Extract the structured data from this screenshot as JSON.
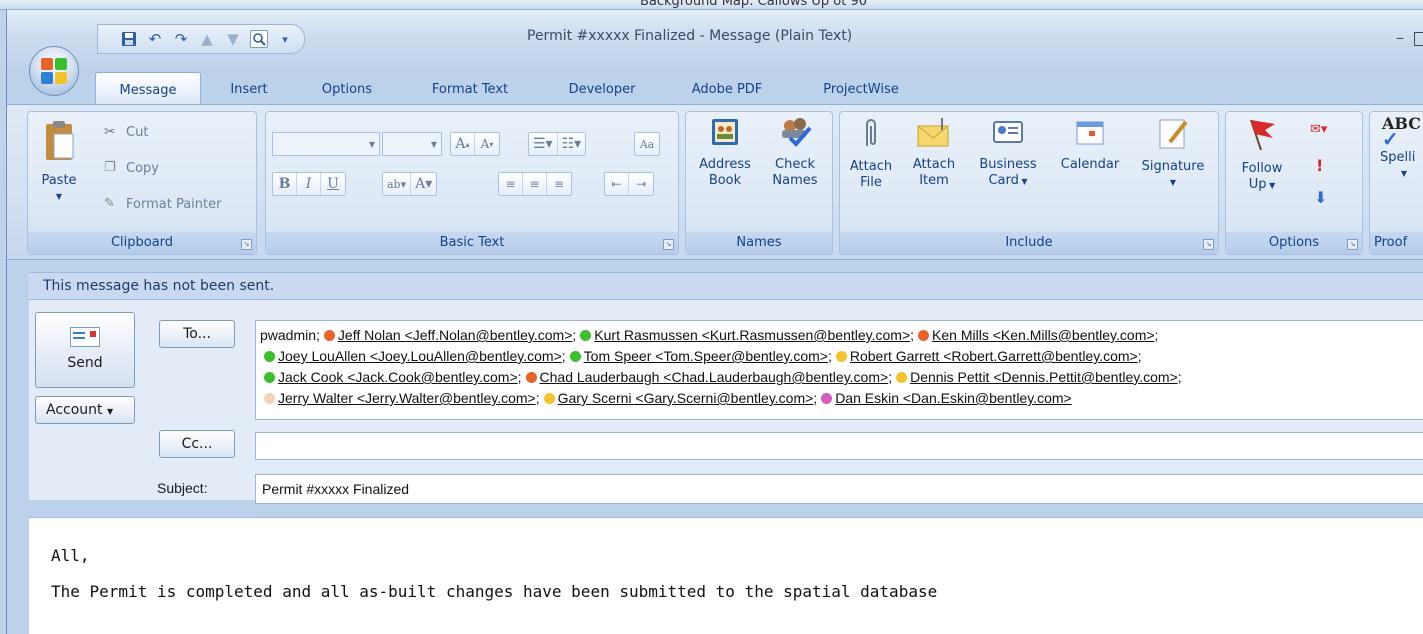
{
  "window": {
    "title": "Permit #xxxxx Finalized - Message (Plain Text)",
    "behind_text": "Background Map: Callows Up ot 90"
  },
  "tabs": [
    "Message",
    "Insert",
    "Options",
    "Format Text",
    "Developer",
    "Adobe PDF",
    "ProjectWise"
  ],
  "ribbon": {
    "clipboard": {
      "label": "Clipboard",
      "paste": "Paste",
      "cut": "Cut",
      "copy": "Copy",
      "format_painter": "Format Painter"
    },
    "basic_text": {
      "label": "Basic Text"
    },
    "names": {
      "label": "Names",
      "address_book": [
        "Address",
        "Book"
      ],
      "check_names": [
        "Check",
        "Names"
      ]
    },
    "include": {
      "label": "Include",
      "attach_file": [
        "Attach",
        "File"
      ],
      "attach_item": [
        "Attach",
        "Item"
      ],
      "business_card": [
        "Business",
        "Card"
      ],
      "calendar": "Calendar",
      "signature": "Signature"
    },
    "options": {
      "label": "Options",
      "follow_up": [
        "Follow",
        "Up"
      ]
    },
    "proofing": {
      "label": "Proof",
      "spelling": "Spelli"
    }
  },
  "info_bar": "This message has not been sent.",
  "compose": {
    "send": "Send",
    "account": "Account",
    "to_button": "To...",
    "cc_button": "Cc...",
    "subject_label": "Subject:",
    "subject": "Permit #xxxxx Finalized",
    "cc_value": "",
    "recipients_lines": [
      [
        {
          "text": "pwadmin;",
          "status": null
        },
        {
          "text": "Jeff Nolan <Jeff.Nolan@bentley.com>;",
          "status": "#e8632a"
        },
        {
          "text": "Kurt Rasmussen <Kurt.Rasmussen@bentley.com>;",
          "status": "#3bbf2c"
        },
        {
          "text": "Ken Mills <Ken.Mills@bentley.com>;",
          "status": "#e8632a"
        }
      ],
      [
        {
          "text": "Joey LouAllen <Joey.LouAllen@bentley.com>;",
          "status": "#3bbf2c"
        },
        {
          "text": "Tom Speer <Tom.Speer@bentley.com>;",
          "status": "#3bbf2c"
        },
        {
          "text": "Robert Garrett <Robert.Garrett@bentley.com>;",
          "status": "#f2c42b"
        }
      ],
      [
        {
          "text": "Jack Cook <Jack.Cook@bentley.com>;",
          "status": "#3bbf2c"
        },
        {
          "text": "Chad Lauderbaugh <Chad.Lauderbaugh@bentley.com>;",
          "status": "#e8632a"
        },
        {
          "text": "Dennis Pettit <Dennis.Pettit@bentley.com>;",
          "status": "#f2c42b"
        }
      ],
      [
        {
          "text": "Jerry Walter <Jerry.Walter@bentley.com>;",
          "status": "#f6d2b4"
        },
        {
          "text": "Gary Scerni <Gary.Scerni@bentley.com>;",
          "status": "#f2c42b"
        },
        {
          "text": "Dan Eskin <Dan.Eskin@bentley.com>",
          "status": "#d65bc0"
        }
      ]
    ]
  },
  "body_lines": [
    "All,",
    "The Permit is completed and all as-built changes have been submitted to the spatial database"
  ]
}
